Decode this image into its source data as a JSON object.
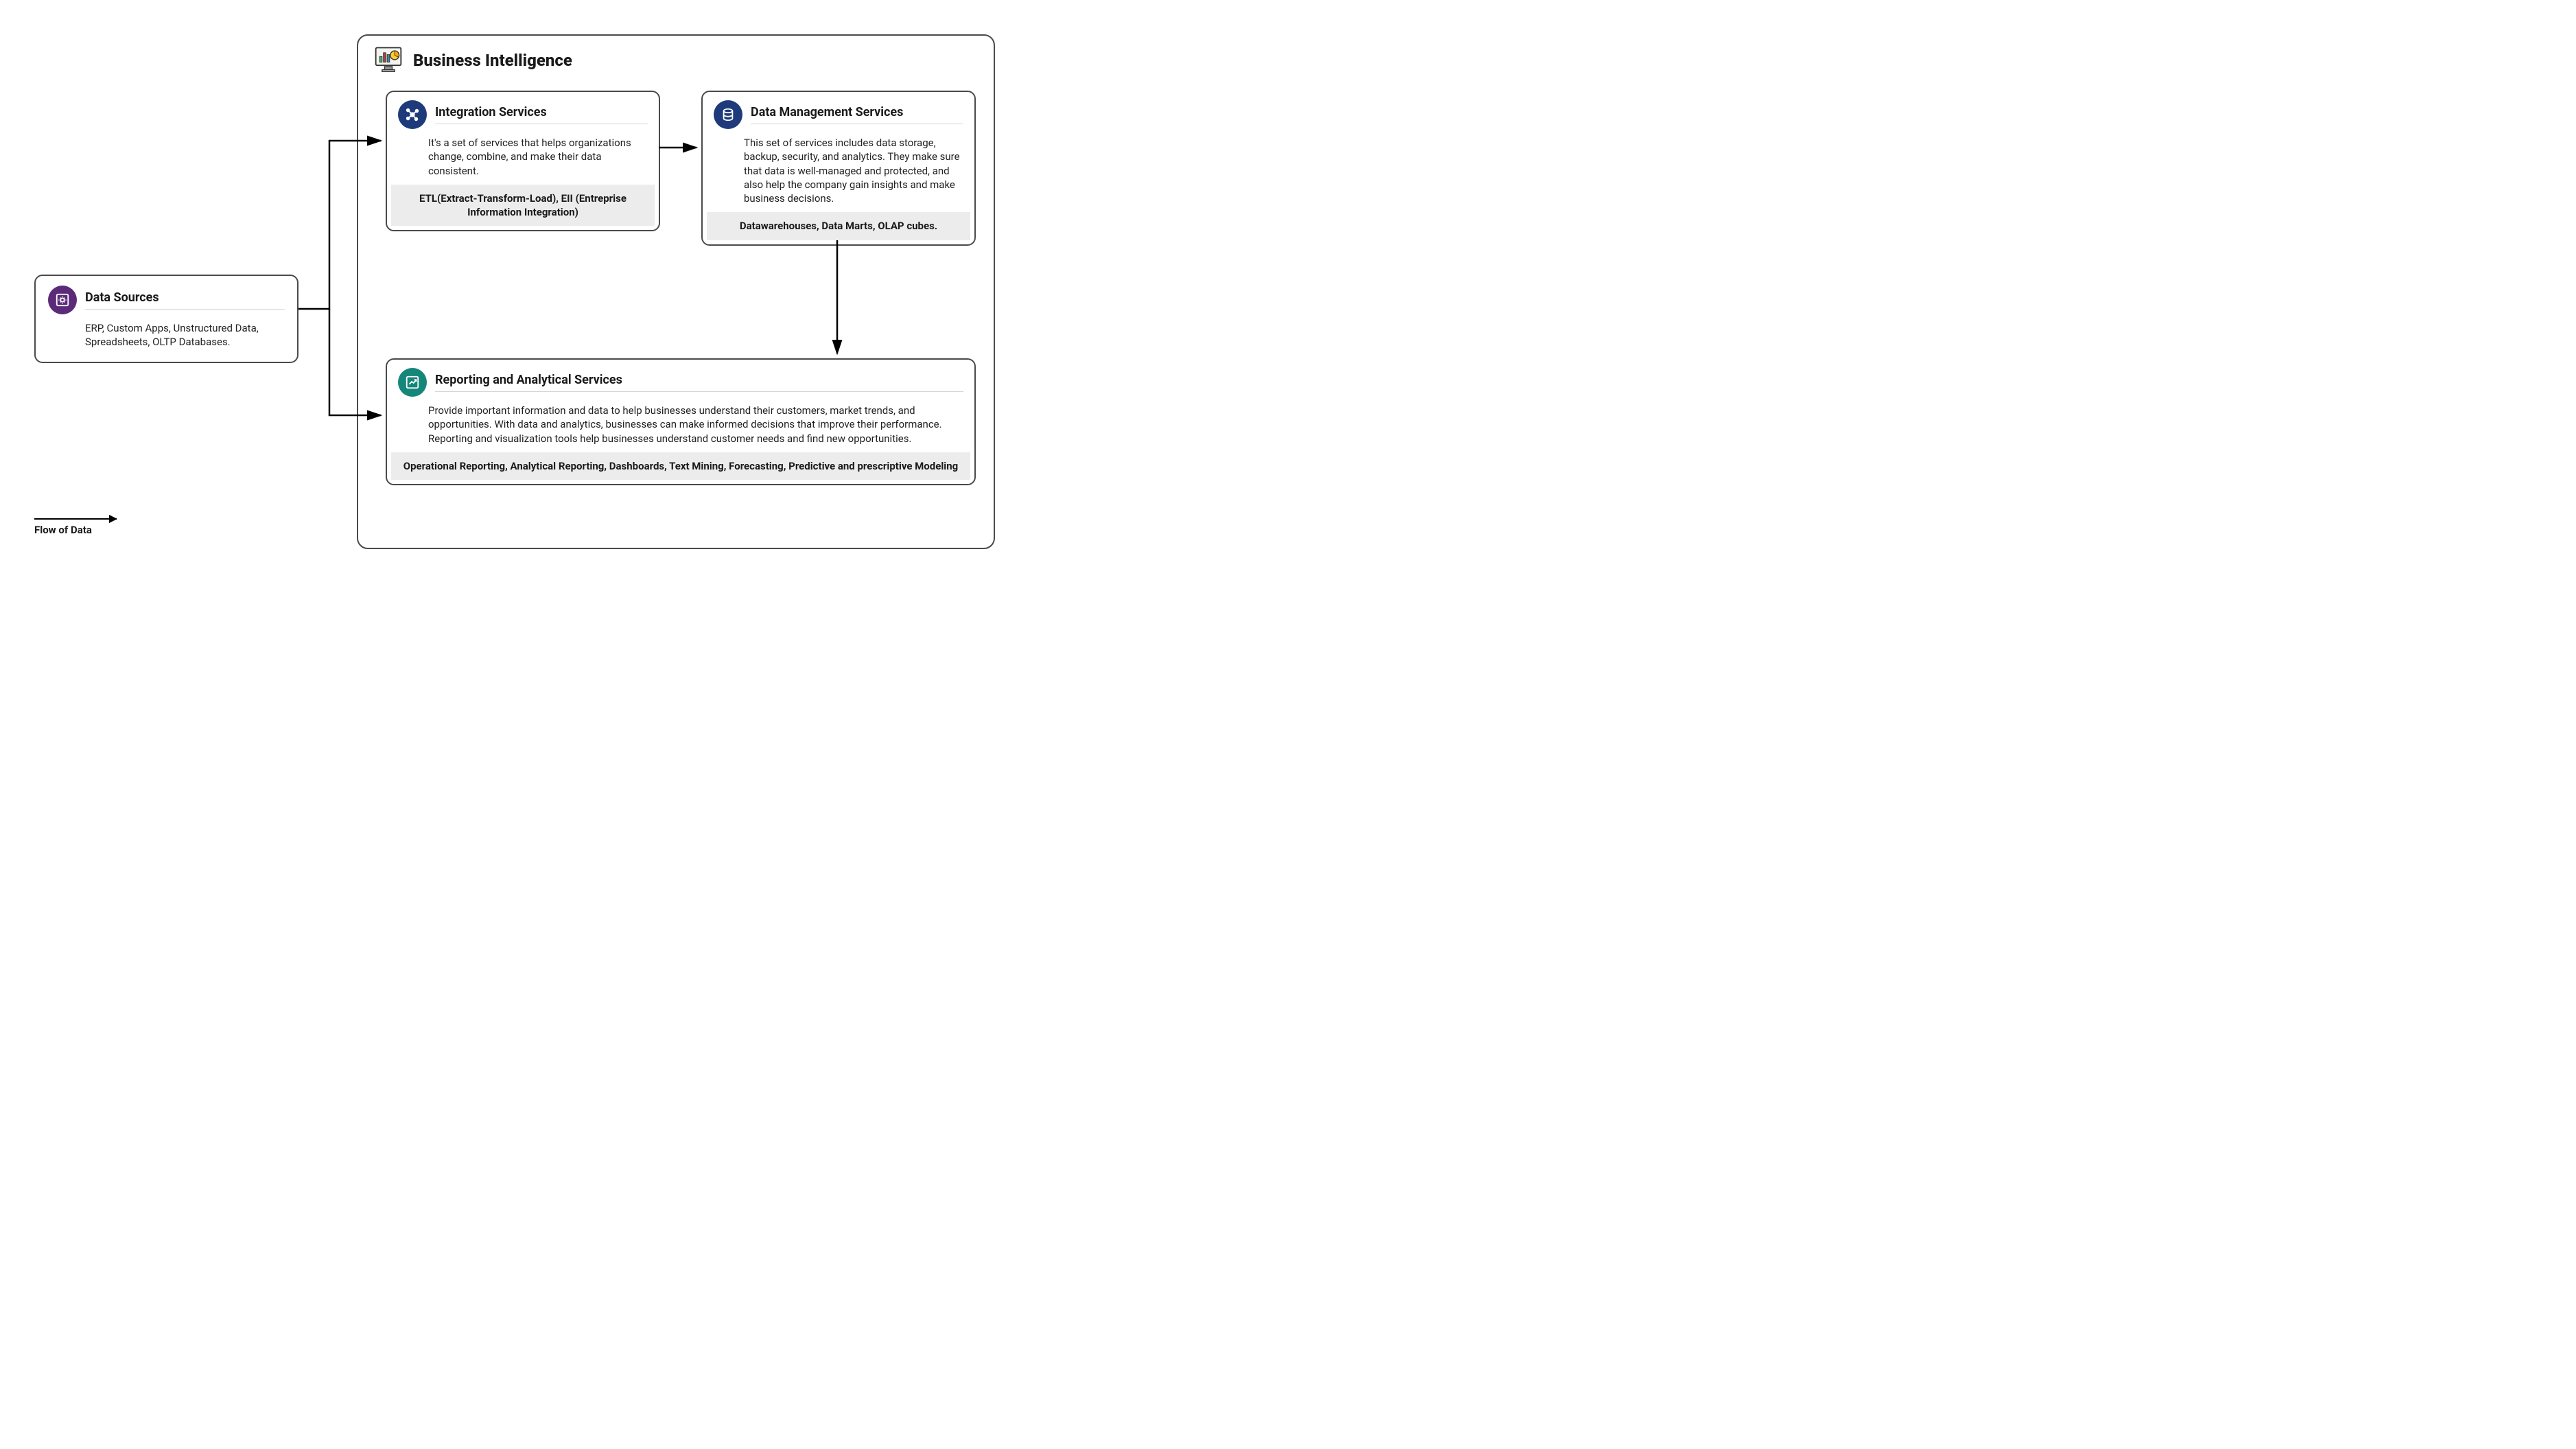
{
  "dataSources": {
    "title": "Data Sources",
    "body": "ERP, Custom Apps, Unstructured Data, Spreadsheets, OLTP Databases."
  },
  "bi": {
    "title": "Business Intelligence",
    "integration": {
      "title": "Integration Services",
      "desc": "It's a set of services that helps organizations change, combine, and make their data consistent.",
      "examples": "ETL(Extract-Transform-Load), EII (Entreprise Information Integration)"
    },
    "dataMgmt": {
      "title": "Data Management Services",
      "desc": "This set of services includes data storage, backup, security, and  analytics. They make sure that data is well-managed and protected, and  also help the company gain insights and make business decisions.",
      "examples": "Datawarehouses, Data Marts, OLAP cubes."
    },
    "reporting": {
      "title": "Reporting and Analytical Services",
      "desc": "Provide important information and data to help businesses understand their customers, market trends, and opportunities. With data and analytics, businesses can make informed decisions that improve their performance. Reporting and visualization tools help businesses understand customer needs and find new opportunities.",
      "examples": "Operational Reporting, Analytical Reporting,  Dashboards, Text Mining, Forecasting, Predictive and prescriptive Modeling"
    }
  },
  "legend": "Flow of Data",
  "icons": {
    "dataSources": "gear-box-icon",
    "bi": "monitor-chart-icon",
    "integration": "nodes-icon",
    "dataMgmt": "database-icon",
    "reporting": "chart-up-icon"
  }
}
